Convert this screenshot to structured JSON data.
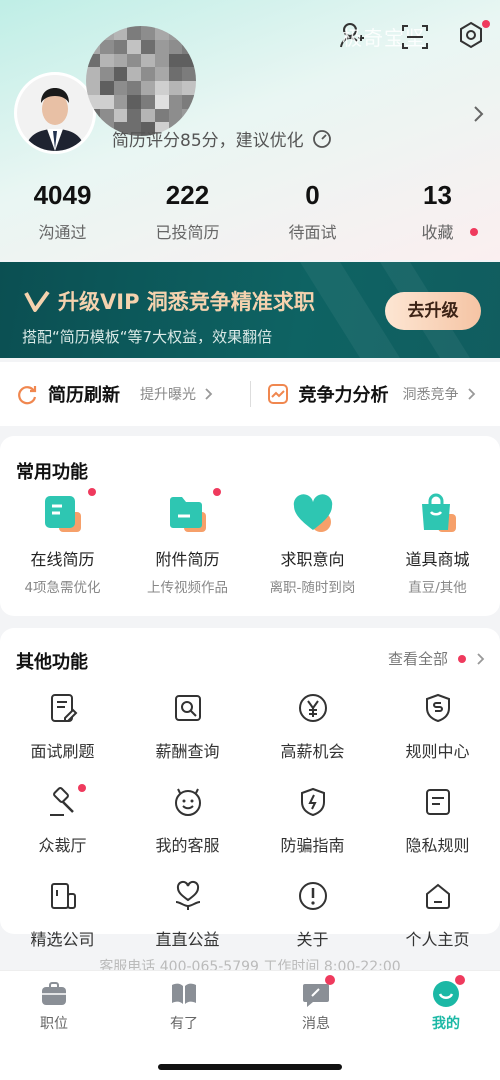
{
  "watermark": "极奇宝坚",
  "profile": {
    "score_text": "简历评分85分，建议优化"
  },
  "stats": [
    {
      "num": "4049",
      "label": "沟通过"
    },
    {
      "num": "222",
      "label": "已投简历"
    },
    {
      "num": "0",
      "label": "待面试"
    },
    {
      "num": "13",
      "label": "收藏"
    }
  ],
  "vip": {
    "title": "升级VIP 洞悉竞争精准求职",
    "subtitle": "搭配“简历模板“等7大权益，效果翻倍",
    "button": "去升级"
  },
  "tools": [
    {
      "name": "简历刷新",
      "hint": "提升曝光"
    },
    {
      "name": "竞争力分析",
      "hint": "洞悉竞争"
    }
  ],
  "common": {
    "title": "常用功能",
    "items": [
      {
        "title": "在线简历",
        "sub": "4项急需优化"
      },
      {
        "title": "附件简历",
        "sub": "上传视频作品"
      },
      {
        "title": "求职意向",
        "sub": "离职-随时到岗"
      },
      {
        "title": "道具商城",
        "sub": "直豆/其他"
      }
    ]
  },
  "other": {
    "title": "其他功能",
    "view_all": "查看全部",
    "items": [
      {
        "label": "面试刷题",
        "icon": "notepad-pen-icon"
      },
      {
        "label": "薪酬查询",
        "icon": "search-doc-icon"
      },
      {
        "label": "高薪机会",
        "icon": "yen-icon"
      },
      {
        "label": "规则中心",
        "icon": "shield-s-icon"
      },
      {
        "label": "众裁厅",
        "icon": "gavel-icon"
      },
      {
        "label": "我的客服",
        "icon": "smiley-icon"
      },
      {
        "label": "防骗指南",
        "icon": "shield-bolt-icon"
      },
      {
        "label": "隐私规则",
        "icon": "doc-lines-icon"
      },
      {
        "label": "精选公司",
        "icon": "building-icon"
      },
      {
        "label": "直直公益",
        "icon": "heart-hand-icon"
      },
      {
        "label": "关于",
        "icon": "info-circle-icon"
      },
      {
        "label": "个人主页",
        "icon": "home-icon"
      }
    ]
  },
  "footer_faded": "客服电话 400-065-5799 工作时间 8:00-22:00",
  "tabs": [
    {
      "label": "职位"
    },
    {
      "label": "有了"
    },
    {
      "label": "消息"
    },
    {
      "label": "我的"
    }
  ],
  "colors": {
    "accent": "#1bb8a5",
    "badge": "#ef3a5d",
    "vip_bg": "#0e5f60",
    "vip_text": "#f5d2ae"
  }
}
